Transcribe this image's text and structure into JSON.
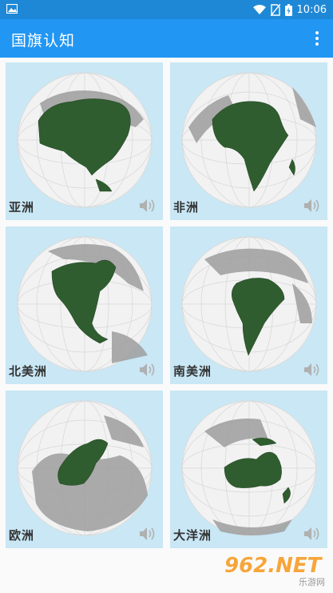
{
  "status_bar": {
    "time": "10:06",
    "icons": [
      "image-icon",
      "wifi-icon",
      "no-sim-icon",
      "battery-icon"
    ]
  },
  "app_bar": {
    "title": "国旗认知",
    "menu_icon": "more-vert-icon"
  },
  "continents": [
    {
      "name": "亚洲",
      "highlight": "#2f5d2f",
      "icon": "speaker-icon"
    },
    {
      "name": "非洲",
      "highlight": "#2f5d2f",
      "icon": "speaker-icon"
    },
    {
      "name": "北美洲",
      "highlight": "#2f5d2f",
      "icon": "speaker-icon"
    },
    {
      "name": "南美洲",
      "highlight": "#2f5d2f",
      "icon": "speaker-icon"
    },
    {
      "name": "欧洲",
      "highlight": "#2f5d2f",
      "icon": "speaker-icon"
    },
    {
      "name": "大洋洲",
      "highlight": "#2f5d2f",
      "icon": "speaker-icon"
    }
  ],
  "watermark": {
    "top": "962.NET",
    "bottom": "乐游网"
  },
  "colors": {
    "status_bar": "#1e88d6",
    "app_bar": "#2196f3",
    "card_bg": "#c9e7f5",
    "land_gray": "#9e9e9e",
    "globe": "#f2f2f2"
  }
}
